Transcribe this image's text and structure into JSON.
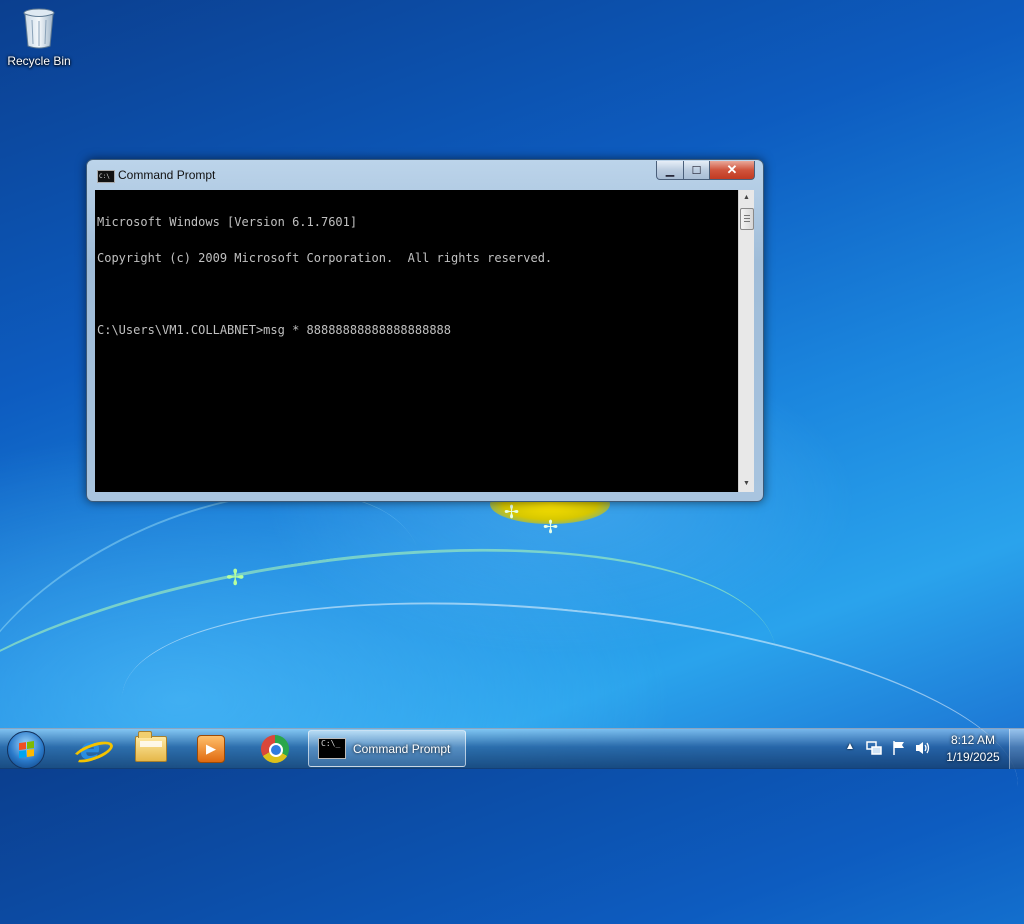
{
  "desktop": {
    "icons": [
      {
        "label": "Recycle Bin",
        "icon": "recycle-bin-icon"
      }
    ]
  },
  "window": {
    "title": "Command Prompt",
    "icon": "cmd-icon",
    "controls": {
      "minimize": "minimize-icon",
      "maximize": "maximize-icon",
      "close": "close-icon"
    },
    "console_lines": [
      "Microsoft Windows [Version 6.1.7601]",
      "Copyright (c) 2009 Microsoft Corporation.  All rights reserved.",
      "",
      "C:\\Users\\VM1.COLLABNET>msg * 88888888888888888888"
    ],
    "console_colors": {
      "background": "#000000",
      "text": "#c0c0c0"
    }
  },
  "taskbar": {
    "start_icon": "windows-start-icon",
    "pinned": [
      {
        "name": "internet-explorer-icon"
      },
      {
        "name": "file-explorer-icon"
      },
      {
        "name": "media-player-icon"
      },
      {
        "name": "chrome-icon"
      }
    ],
    "active_task": {
      "label": "Command Prompt",
      "icon": "cmd-icon"
    },
    "tray": {
      "icons": [
        "show-hidden-icons-icon",
        "network-icon",
        "action-center-flag-icon",
        "volume-icon"
      ],
      "time": "8:12 AM",
      "date": "1/19/2025"
    }
  },
  "colors": {
    "desktop_blue": "#1b86de",
    "taskbar": "#2a5a8e",
    "close_button": "#c13a22"
  }
}
